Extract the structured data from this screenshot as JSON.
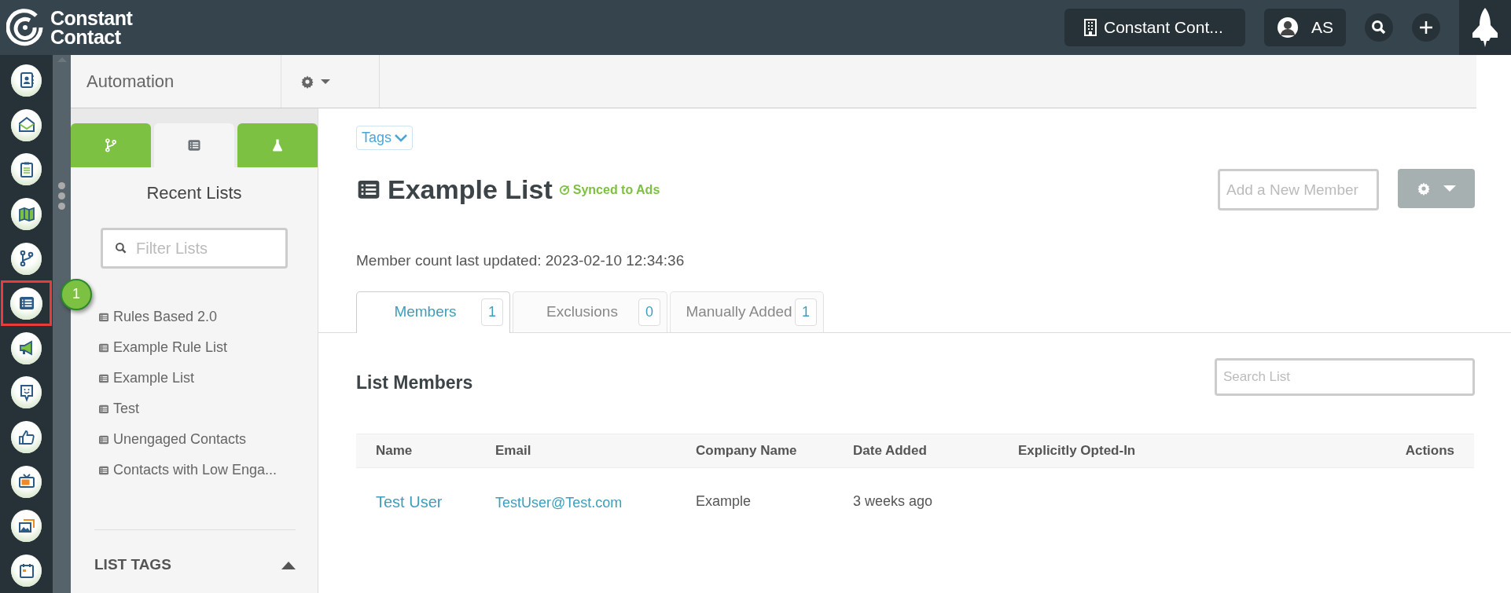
{
  "header": {
    "logo_line1": "Constant",
    "logo_line2": "Contact",
    "account": "Constant Cont...",
    "user_initials": "AS"
  },
  "rail": [
    {
      "kind": "contacts",
      "selected": false
    },
    {
      "kind": "email",
      "selected": false
    },
    {
      "kind": "clipboard",
      "selected": false
    },
    {
      "kind": "map",
      "selected": false
    },
    {
      "kind": "branch",
      "selected": false
    },
    {
      "kind": "list",
      "selected": true,
      "callout": "1"
    },
    {
      "kind": "megaphone",
      "selected": false
    },
    {
      "kind": "chat",
      "selected": false
    },
    {
      "kind": "thumb",
      "selected": false
    },
    {
      "kind": "tv",
      "selected": false
    },
    {
      "kind": "image",
      "selected": false
    },
    {
      "kind": "calendar",
      "selected": false
    }
  ],
  "toolbar": {
    "title": "Automation"
  },
  "side_tabs": [
    {
      "kind": "branch",
      "selected": false
    },
    {
      "kind": "list",
      "selected": true
    },
    {
      "kind": "flask",
      "selected": false
    }
  ],
  "recent_lists": {
    "title": "Recent Lists",
    "filter_placeholder": "Filter Lists",
    "items": [
      "Rules Based 2.0",
      "Example Rule List",
      "Example List",
      "Test",
      "Unengaged Contacts",
      "Contacts with Low Enga..."
    ]
  },
  "list_tags": {
    "title": "LIST TAGS",
    "expanded": true
  },
  "main": {
    "tags_label": "Tags",
    "title": "Example List",
    "sync_label": "Synced to Ads",
    "add_member_placeholder": "Add a New Member",
    "updated": "Member count last updated: 2023-02-10 12:34:36",
    "tabs": [
      {
        "label": "Members",
        "count": "1",
        "selected": true
      },
      {
        "label": "Exclusions",
        "count": "0",
        "selected": false
      },
      {
        "label": "Manually Added",
        "count": "1",
        "selected": false
      }
    ],
    "section_title": "List Members",
    "search_placeholder": "Search List",
    "columns": [
      "Name",
      "Email",
      "Company Name",
      "Date Added",
      "Explicitly Opted-In",
      "Actions"
    ],
    "rows": [
      {
        "name": "Test User",
        "email": "TestUser@Test.com",
        "company": "Example",
        "date_added": "3 weeks ago"
      }
    ]
  }
}
